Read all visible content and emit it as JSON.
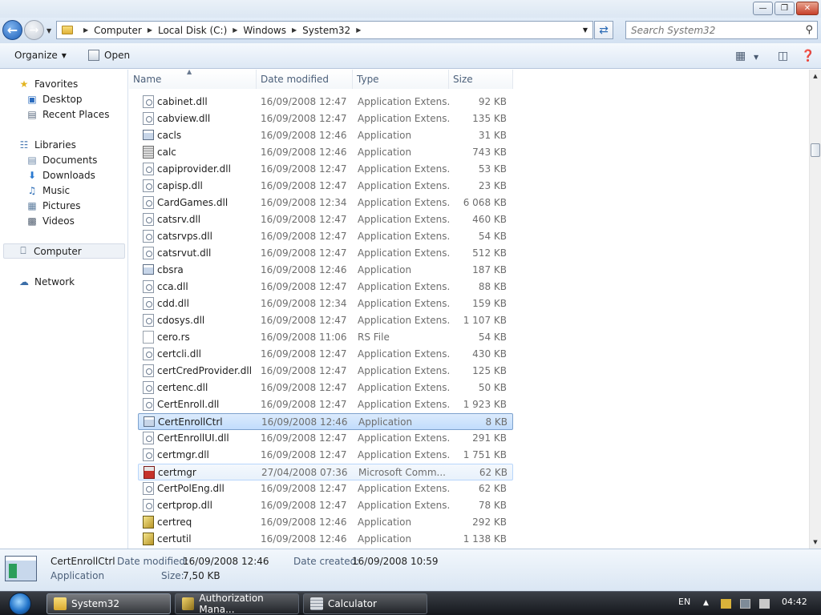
{
  "address": {
    "crumbs": [
      "Computer",
      "Local Disk (C:)",
      "Windows",
      "System32"
    ]
  },
  "search": {
    "placeholder": "Search System32"
  },
  "toolbar": {
    "organize": "Organize",
    "open": "Open"
  },
  "nav": {
    "favorites": "Favorites",
    "desktop": "Desktop",
    "recent": "Recent Places",
    "libraries": "Libraries",
    "documents": "Documents",
    "downloads": "Downloads",
    "music": "Music",
    "pictures": "Pictures",
    "videos": "Videos",
    "computer": "Computer",
    "network": "Network"
  },
  "columns": {
    "name": "Name",
    "date": "Date modified",
    "type": "Type",
    "size": "Size"
  },
  "files": [
    {
      "name": "cabinet.dll",
      "date": "16/09/2008 12:47",
      "type": "Application Extens...",
      "size": "92 KB",
      "icon": "dll"
    },
    {
      "name": "cabview.dll",
      "date": "16/09/2008 12:47",
      "type": "Application Extens...",
      "size": "135 KB",
      "icon": "dll"
    },
    {
      "name": "cacls",
      "date": "16/09/2008 12:46",
      "type": "Application",
      "size": "31 KB",
      "icon": "app"
    },
    {
      "name": "calc",
      "date": "16/09/2008 12:46",
      "type": "Application",
      "size": "743 KB",
      "icon": "calc"
    },
    {
      "name": "capiprovider.dll",
      "date": "16/09/2008 12:47",
      "type": "Application Extens...",
      "size": "53 KB",
      "icon": "dll"
    },
    {
      "name": "capisp.dll",
      "date": "16/09/2008 12:47",
      "type": "Application Extens...",
      "size": "23 KB",
      "icon": "dll"
    },
    {
      "name": "CardGames.dll",
      "date": "16/09/2008 12:34",
      "type": "Application Extens...",
      "size": "6 068 KB",
      "icon": "dll"
    },
    {
      "name": "catsrv.dll",
      "date": "16/09/2008 12:47",
      "type": "Application Extens...",
      "size": "460 KB",
      "icon": "dll"
    },
    {
      "name": "catsrvps.dll",
      "date": "16/09/2008 12:47",
      "type": "Application Extens...",
      "size": "54 KB",
      "icon": "dll"
    },
    {
      "name": "catsrvut.dll",
      "date": "16/09/2008 12:47",
      "type": "Application Extens...",
      "size": "512 KB",
      "icon": "dll"
    },
    {
      "name": "cbsra",
      "date": "16/09/2008 12:46",
      "type": "Application",
      "size": "187 KB",
      "icon": "app"
    },
    {
      "name": "cca.dll",
      "date": "16/09/2008 12:47",
      "type": "Application Extens...",
      "size": "88 KB",
      "icon": "dll"
    },
    {
      "name": "cdd.dll",
      "date": "16/09/2008 12:34",
      "type": "Application Extens...",
      "size": "159 KB",
      "icon": "dll"
    },
    {
      "name": "cdosys.dll",
      "date": "16/09/2008 12:47",
      "type": "Application Extens...",
      "size": "1 107 KB",
      "icon": "dll"
    },
    {
      "name": "cero.rs",
      "date": "16/09/2008 11:06",
      "type": "RS File",
      "size": "54 KB",
      "icon": "plain"
    },
    {
      "name": "certcli.dll",
      "date": "16/09/2008 12:47",
      "type": "Application Extens...",
      "size": "430 KB",
      "icon": "dll"
    },
    {
      "name": "certCredProvider.dll",
      "date": "16/09/2008 12:47",
      "type": "Application Extens...",
      "size": "125 KB",
      "icon": "dll"
    },
    {
      "name": "certenc.dll",
      "date": "16/09/2008 12:47",
      "type": "Application Extens...",
      "size": "50 KB",
      "icon": "dll"
    },
    {
      "name": "CertEnroll.dll",
      "date": "16/09/2008 12:47",
      "type": "Application Extens...",
      "size": "1 923 KB",
      "icon": "dll"
    },
    {
      "name": "CertEnrollCtrl",
      "date": "16/09/2008 12:46",
      "type": "Application",
      "size": "8 KB",
      "icon": "app",
      "state": "selected"
    },
    {
      "name": "CertEnrollUI.dll",
      "date": "16/09/2008 12:47",
      "type": "Application Extens...",
      "size": "291 KB",
      "icon": "dll"
    },
    {
      "name": "certmgr.dll",
      "date": "16/09/2008 12:47",
      "type": "Application Extens...",
      "size": "1 751 KB",
      "icon": "dll"
    },
    {
      "name": "certmgr",
      "date": "27/04/2008 07:36",
      "type": "Microsoft Comm...",
      "size": "62 KB",
      "icon": "msc",
      "state": "hover"
    },
    {
      "name": "CertPolEng.dll",
      "date": "16/09/2008 12:47",
      "type": "Application Extens...",
      "size": "62 KB",
      "icon": "dll"
    },
    {
      "name": "certprop.dll",
      "date": "16/09/2008 12:47",
      "type": "Application Extens...",
      "size": "78 KB",
      "icon": "dll"
    },
    {
      "name": "certreq",
      "date": "16/09/2008 12:46",
      "type": "Application",
      "size": "292 KB",
      "icon": "cert"
    },
    {
      "name": "certutil",
      "date": "16/09/2008 12:46",
      "type": "Application",
      "size": "1 138 KB",
      "icon": "cert"
    }
  ],
  "details": {
    "name": "CertEnrollCtrl",
    "kind": "Application",
    "modified_label": "Date modified:",
    "modified_value": "16/09/2008 12:46",
    "created_label": "Date created:",
    "created_value": "16/09/2008 10:59",
    "size_label": "Size:",
    "size_value": "7,50 KB"
  },
  "taskbar": {
    "items": [
      "System32",
      "Authorization Mana...",
      "Calculator"
    ],
    "lang": "EN",
    "time": "04:42"
  },
  "colors": {
    "selection": "#c1dcfc",
    "hover": "#e8f1fb",
    "accent": "#1d5fb8"
  }
}
